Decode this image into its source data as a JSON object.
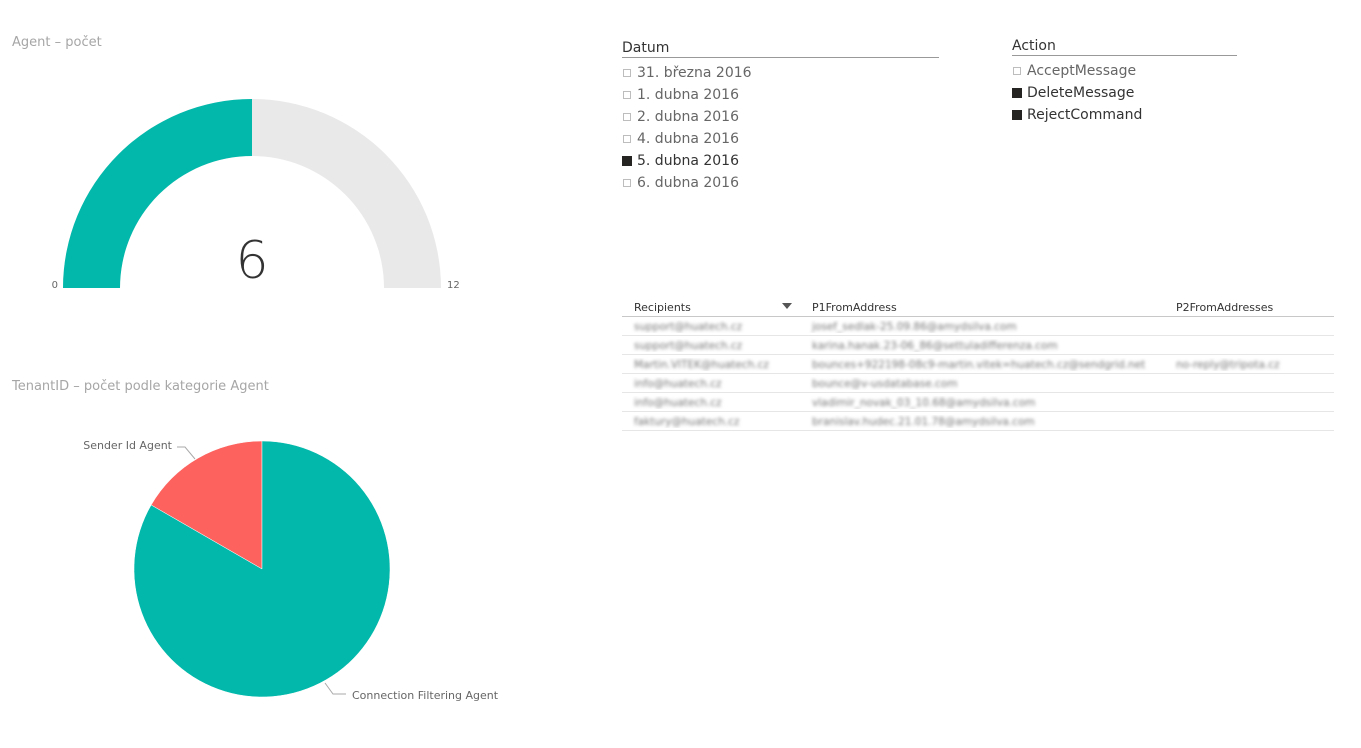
{
  "colors": {
    "teal": "#01B8AA",
    "red": "#FD625E",
    "track": "#E9E9E9"
  },
  "gauge": {
    "title": "Agent – počet",
    "min_label": "0",
    "max_label": "12",
    "value_label": "6"
  },
  "pie": {
    "title": "TenantID – počet podle kategorie Agent"
  },
  "chart_data": [
    {
      "type": "gauge",
      "title": "Agent – počet",
      "value": 6,
      "min": 0,
      "max": 12
    },
    {
      "type": "pie",
      "title": "TenantID – počet podle kategorie Agent",
      "categories": [
        "Sender Id Agent",
        "Connection Filtering Agent"
      ],
      "values": [
        1,
        5
      ],
      "colors": [
        "#FD625E",
        "#01B8AA"
      ]
    }
  ],
  "datum_slicer": {
    "header": "Datum",
    "items": [
      {
        "label": "31. března 2016",
        "selected": false
      },
      {
        "label": "1. dubna 2016",
        "selected": false
      },
      {
        "label": "2. dubna 2016",
        "selected": false
      },
      {
        "label": "4. dubna 2016",
        "selected": false
      },
      {
        "label": "5. dubna 2016",
        "selected": true
      },
      {
        "label": "6. dubna 2016",
        "selected": false
      }
    ]
  },
  "action_slicer": {
    "header": "Action",
    "items": [
      {
        "label": "AcceptMessage",
        "selected": false
      },
      {
        "label": "DeleteMessage",
        "selected": true
      },
      {
        "label": "RejectCommand",
        "selected": true
      }
    ]
  },
  "table": {
    "columns": [
      "Recipients",
      "P1FromAddress",
      "P2FromAddresses"
    ],
    "sorted_column": "Recipients",
    "rows": [
      [
        "support@huatech.cz",
        "josef_sedlak-25.09.86@amydsilva.com",
        ""
      ],
      [
        "support@huatech.cz",
        "karina.hanak.23-06_86@settuladifferenza.com",
        ""
      ],
      [
        "Martin.VITEK@huatech.cz",
        "bounces+922198-08c9-martin.vitek=huatech.cz@sendgrid.net",
        "no-reply@tripota.cz"
      ],
      [
        "info@huatech.cz",
        "bounce@v-usdatabase.com",
        ""
      ],
      [
        "info@huatech.cz",
        "vladimir_novak_03_10.68@amydsilva.com",
        ""
      ],
      [
        "faktury@huatech.cz",
        "branislav.hudec.21.01.78@amydsilva.com",
        ""
      ]
    ]
  }
}
